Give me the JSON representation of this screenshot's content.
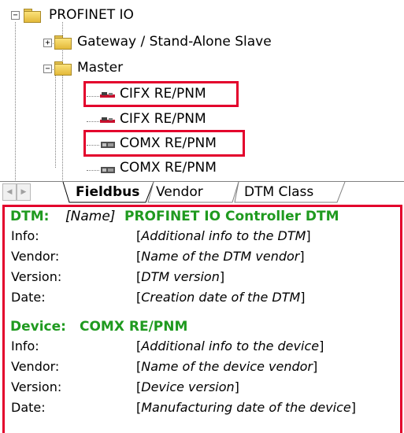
{
  "tree": {
    "root": {
      "label": "PROFINET IO",
      "expander": "−"
    },
    "gateway": {
      "label": "Gateway / Stand-Alone Slave",
      "expander": "+"
    },
    "master": {
      "label": "Master",
      "expander": "−"
    },
    "devices": [
      {
        "label": "CIFX RE/PNM",
        "icon": "cifx-card-icon",
        "highlighted": true
      },
      {
        "label": "CIFX RE/PNM",
        "icon": "cifx-card-icon",
        "highlighted": false
      },
      {
        "label": "COMX RE/PNM",
        "icon": "comx-module-icon",
        "highlighted": true
      },
      {
        "label": "COMX RE/PNM",
        "icon": "comx-module-icon",
        "highlighted": false
      }
    ]
  },
  "tabs": {
    "scroll_left": "◀",
    "scroll_right": "▶",
    "items": [
      {
        "label": "Fieldbus",
        "active": true
      },
      {
        "label": "Vendor",
        "active": false
      },
      {
        "label": "DTM Class",
        "active": false
      }
    ]
  },
  "dtm": {
    "heading": "DTM:",
    "name_placeholder": "[Name]",
    "name": "PROFINET IO Controller DTM",
    "rows": [
      {
        "label": "Info:",
        "value": "Additional info to the DTM"
      },
      {
        "label": "Vendor:",
        "value": "Name of the DTM vendor"
      },
      {
        "label": "Version:",
        "value": "DTM version"
      },
      {
        "label": "Date:",
        "value": "Creation date of the DTM"
      }
    ]
  },
  "device": {
    "heading": "Device:",
    "name": "COMX RE/PNM",
    "rows": [
      {
        "label": "Info:",
        "value": "Additional info to the device"
      },
      {
        "label": "Vendor:",
        "value": "Name of the device vendor"
      },
      {
        "label": "Version:",
        "value": "Device version"
      },
      {
        "label": "Date:",
        "value": "Manufacturing date of the device"
      }
    ]
  },
  "colors": {
    "highlight": "#e3002c",
    "heading_green": "#1f9a1f",
    "folder": "#f2cf52"
  }
}
